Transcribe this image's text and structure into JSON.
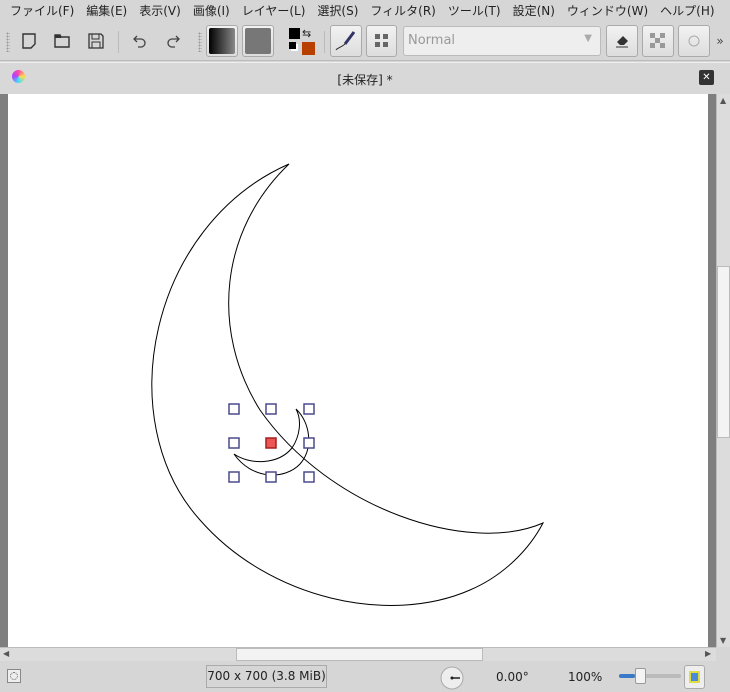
{
  "menubar": {
    "items": [
      "ファイル(F)",
      "編集(E)",
      "表示(V)",
      "画像(I)",
      "レイヤー(L)",
      "選択(S)",
      "フィルタ(R)",
      "ツール(T)",
      "設定(N)",
      "ウィンドウ(W)",
      "ヘルプ(H)"
    ]
  },
  "toolbar": {
    "blend_mode": "Normal",
    "overflow": "»",
    "foreground_color": "#000000",
    "background_color": "#b84000"
  },
  "document": {
    "title": "[未保存] *"
  },
  "status": {
    "dimensions": "700 x 700 (3.8 MiB)",
    "rotation": "0.00°",
    "zoom": "100%",
    "zoom_slider_level": 0.25
  },
  "selection": {
    "handle_active_color": "#ee5555",
    "handle_color": "#4a4a8c"
  }
}
